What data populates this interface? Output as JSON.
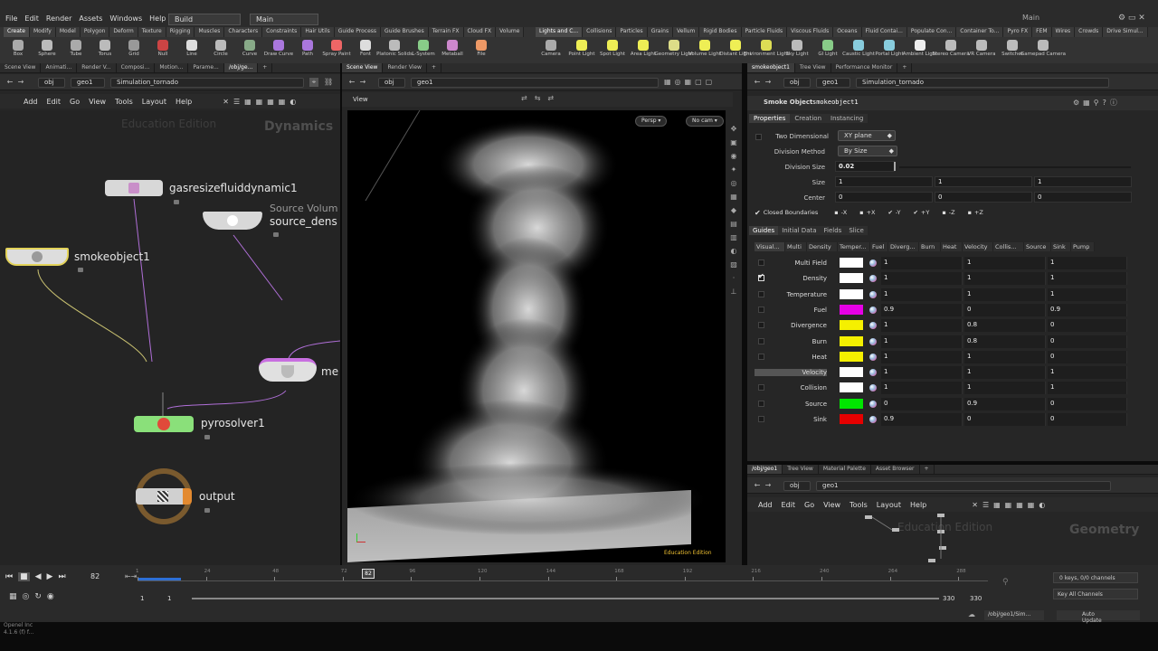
{
  "menu": [
    "File",
    "Edit",
    "Render",
    "Assets",
    "Windows",
    "Help"
  ],
  "desktop": {
    "build": "Build",
    "main": "Main",
    "main_right": "Main"
  },
  "shelf_tabs_left": [
    "Create",
    "Modify",
    "Model",
    "Polygon",
    "Deform",
    "Texture",
    "Rigging",
    "Muscles",
    "Characters",
    "Constraints",
    "Hair Utils",
    "Guide Process",
    "Guide Brushes",
    "Terrain FX",
    "Cloud FX",
    "Volume"
  ],
  "shelf_tabs_right": [
    "Lights and C...",
    "Collisions",
    "Particles",
    "Grains",
    "Vellum",
    "Rigid Bodies",
    "Particle Fluids",
    "Viscous Fluids",
    "Oceans",
    "Fluid Contai...",
    "Populate Con...",
    "Container To...",
    "Pyro FX",
    "FEM",
    "Wires",
    "Crowds",
    "Drive Simul..."
  ],
  "tools_left": [
    "Box",
    "Sphere",
    "Tube",
    "Torus",
    "Grid",
    "Null",
    "Line",
    "Circle",
    "Curve",
    "Draw Curve",
    "Path",
    "Spray Paint",
    "Font",
    "Platonic Solids",
    "L-System",
    "Metaball",
    "File"
  ],
  "tools_right": [
    "Camera",
    "Point Light",
    "Spot Light",
    "Area Light",
    "Geometry Light",
    "Volume Light",
    "Distant Light",
    "Environment Light",
    "Sky Light",
    "GI Light",
    "Caustic Light",
    "Portal Light",
    "Ambient Light",
    "Stereo Camera",
    "VR Camera",
    "Switcher",
    "Gamepad Camera"
  ],
  "network": {
    "tabs": [
      "Scene View",
      "Animati...",
      "Render V...",
      "Composi...",
      "Motion...",
      "Parame...",
      "/obj/ge..."
    ],
    "path": {
      "obj": "obj",
      "geo": "geo1",
      "sim": "Simulation_tornado"
    },
    "menu": [
      "Add",
      "Edit",
      "Go",
      "View",
      "Tools",
      "Layout",
      "Help"
    ],
    "watermark": "Education Edition",
    "context": "Dynamics",
    "nodes": {
      "resize": "gasresizefluiddynamic1",
      "source": "source_dens",
      "source_hint": "Source Volum",
      "smoke": "smokeobject1",
      "merge": "me",
      "pyro": "pyrosolver1",
      "output": "output"
    }
  },
  "viewport": {
    "tabs": [
      "Scene View",
      "Render View"
    ],
    "path": {
      "obj": "obj",
      "geo": "geo1"
    },
    "title": "View",
    "persp": "Persp",
    "cam": "No cam",
    "watermark": "Education Edition"
  },
  "params": {
    "tabs": [
      "smokeobject1",
      "Tree View",
      "Performance Monitor"
    ],
    "path": {
      "obj": "obj",
      "geo": "geo1",
      "sim": "Simulation_tornado"
    },
    "node_type": "Smoke Object",
    "node_name": "smokeobject1",
    "ptabs": [
      "Properties",
      "Creation",
      "Instancing"
    ],
    "two_dim": "Two Dimensional",
    "two_dim_val": "XY plane",
    "div_method": "Division Method",
    "div_method_val": "By Size",
    "div_size": "Division Size",
    "div_size_val": "0.02",
    "size": "Size",
    "size_vals": [
      "1",
      "1",
      "1"
    ],
    "center": "Center",
    "center_vals": [
      "0",
      "0",
      "0"
    ],
    "closed": "Closed Boundaries",
    "bounds": [
      "-X",
      "+X",
      "-Y",
      "+Y",
      "-Z",
      "+Z"
    ],
    "stabs": [
      "Guides",
      "Initial Data",
      "Fields",
      "Slice"
    ],
    "vtabs": [
      "Visual...",
      "Multi",
      "Density",
      "Temper...",
      "Fuel",
      "Diverg...",
      "Burn",
      "Heat",
      "Velocity",
      "Collis...",
      "Source",
      "Sink",
      "Pump"
    ],
    "rows": [
      {
        "name": "Multi Field",
        "color": "#ffffff",
        "v": [
          "1",
          "1",
          "1"
        ],
        "on": false
      },
      {
        "name": "Density",
        "color": "#ffffff",
        "v": [
          "1",
          "1",
          "1"
        ],
        "on": true
      },
      {
        "name": "Temperature",
        "color": "#ffffff",
        "v": [
          "1",
          "1",
          "1"
        ],
        "on": false
      },
      {
        "name": "Fuel",
        "color": "#e600e6",
        "v": [
          "0.9",
          "0",
          "0.9"
        ],
        "on": false
      },
      {
        "name": "Divergence",
        "color": "#f5f000",
        "v": [
          "1",
          "0.8",
          "0"
        ],
        "on": false
      },
      {
        "name": "Burn",
        "color": "#f5f000",
        "v": [
          "1",
          "0.8",
          "0"
        ],
        "on": false
      },
      {
        "name": "Heat",
        "color": "#f5f000",
        "v": [
          "1",
          "1",
          "0"
        ],
        "on": false
      },
      {
        "name": "Velocity",
        "color": "#ffffff",
        "v": [
          "1",
          "1",
          "1"
        ],
        "on": false
      },
      {
        "name": "Collision",
        "color": "#ffffff",
        "v": [
          "1",
          "1",
          "1"
        ],
        "on": false
      },
      {
        "name": "Source",
        "color": "#00e600",
        "v": [
          "0",
          "0.9",
          "0"
        ],
        "on": false
      },
      {
        "name": "Sink",
        "color": "#e60000",
        "v": [
          "0.9",
          "0",
          "0"
        ],
        "on": false
      }
    ]
  },
  "geo": {
    "tabs": [
      "/obj/geo1",
      "Tree View",
      "Material Palette",
      "Asset Browser"
    ],
    "path": {
      "obj": "obj",
      "geo": "geo1"
    },
    "menu": [
      "Add",
      "Edit",
      "Go",
      "View",
      "Tools",
      "Layout",
      "Help"
    ],
    "watermark": "Education Edition",
    "context": "Geometry"
  },
  "timeline": {
    "frame": "82",
    "marker": "82",
    "ticks": [
      "1",
      "24",
      "48",
      "72",
      "96",
      "120",
      "144",
      "168",
      "192",
      "216",
      "240",
      "264",
      "288"
    ],
    "range_start": "1",
    "range_start2": "1",
    "range_end": "330",
    "range_end2": "330",
    "keys": "0 keys, 0/0 channels",
    "key_all": "Key All Channels"
  },
  "status": {
    "path": "/obj/geo1/Sim...",
    "update": "Auto Update",
    "left1": "Openel Inc",
    "left2": "4.1.6 (f) f..."
  }
}
